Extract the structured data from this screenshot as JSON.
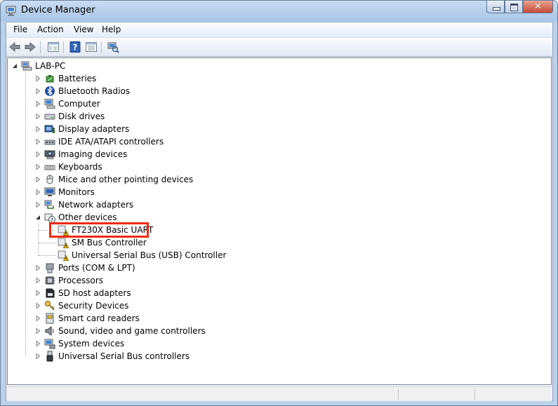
{
  "window": {
    "title": "Device Manager"
  },
  "menu": {
    "file": "File",
    "action": "Action",
    "view": "View",
    "help": "Help"
  },
  "toolbar": {
    "buttons": [
      "back-icon",
      "forward-icon",
      "show-hide-console-tree-icon",
      "help-icon",
      "properties-icon",
      "scan-hardware-icon"
    ]
  },
  "tree": {
    "root": "LAB-PC",
    "categories": [
      {
        "label": "Batteries",
        "icon": "battery-icon"
      },
      {
        "label": "Bluetooth Radios",
        "icon": "bluetooth-icon"
      },
      {
        "label": "Computer",
        "icon": "computer-icon"
      },
      {
        "label": "Disk drives",
        "icon": "disk-drive-icon"
      },
      {
        "label": "Display adapters",
        "icon": "display-adapter-icon"
      },
      {
        "label": "IDE ATA/ATAPI controllers",
        "icon": "ide-controller-icon"
      },
      {
        "label": "Imaging devices",
        "icon": "camera-icon"
      },
      {
        "label": "Keyboards",
        "icon": "keyboard-icon"
      },
      {
        "label": "Mice and other pointing devices",
        "icon": "mouse-icon"
      },
      {
        "label": "Monitors",
        "icon": "monitor-icon"
      },
      {
        "label": "Network adapters",
        "icon": "network-adapter-icon"
      },
      {
        "label": "Other devices",
        "icon": "unknown-device-icon",
        "expanded": true
      }
    ],
    "other_devices": [
      {
        "label": "FT230X Basic UART",
        "icon": "warning-device-icon"
      },
      {
        "label": "SM Bus Controller",
        "icon": "warning-device-icon"
      },
      {
        "label": "Universal Serial Bus (USB) Controller",
        "icon": "warning-device-icon"
      }
    ],
    "categories_after": [
      {
        "label": "Ports (COM & LPT)",
        "icon": "port-icon"
      },
      {
        "label": "Processors",
        "icon": "processor-icon"
      },
      {
        "label": "SD host adapters",
        "icon": "sd-adapter-icon"
      },
      {
        "label": "Security Devices",
        "icon": "key-icon"
      },
      {
        "label": "Smart card readers",
        "icon": "smart-card-icon"
      },
      {
        "label": "Sound, video and game controllers",
        "icon": "speaker-icon"
      },
      {
        "label": "System devices",
        "icon": "system-device-icon"
      },
      {
        "label": "Universal Serial Bus controllers",
        "icon": "usb-icon"
      }
    ]
  },
  "colors": {
    "highlight": "#ee2a10",
    "warning": "#f5c518"
  }
}
